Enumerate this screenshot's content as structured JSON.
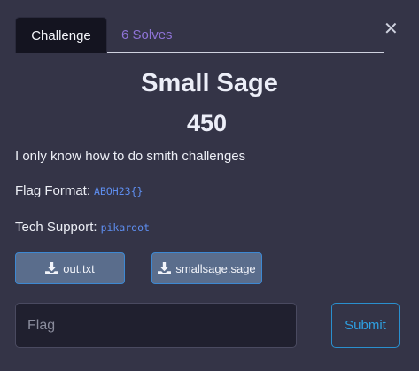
{
  "tabs": [
    {
      "label": "Challenge",
      "active": true
    },
    {
      "label": "6 Solves",
      "active": false
    }
  ],
  "close": {
    "glyph": "✕"
  },
  "challenge": {
    "name": "Small Sage",
    "points": "450",
    "description": "I only know how to do smith challenges",
    "flag_format_label": "Flag Format:",
    "flag_format_value": "ABOH23{}",
    "tech_support_label": "Tech Support:",
    "tech_support_value": "pikaroot"
  },
  "files": [
    {
      "name": "out.txt",
      "icon": "download-icon"
    },
    {
      "name": "smallsage.sage",
      "icon": "download-icon"
    }
  ],
  "submission": {
    "placeholder": "Flag",
    "value": "",
    "submit_label": "Submit"
  },
  "colors": {
    "background": "#343447",
    "active_tab": "#141420",
    "solves_tab": "#8e73d6",
    "code": "#5e8ef0",
    "file_button": "#5a6d8c",
    "submit_accent": "#2e9fe0"
  }
}
